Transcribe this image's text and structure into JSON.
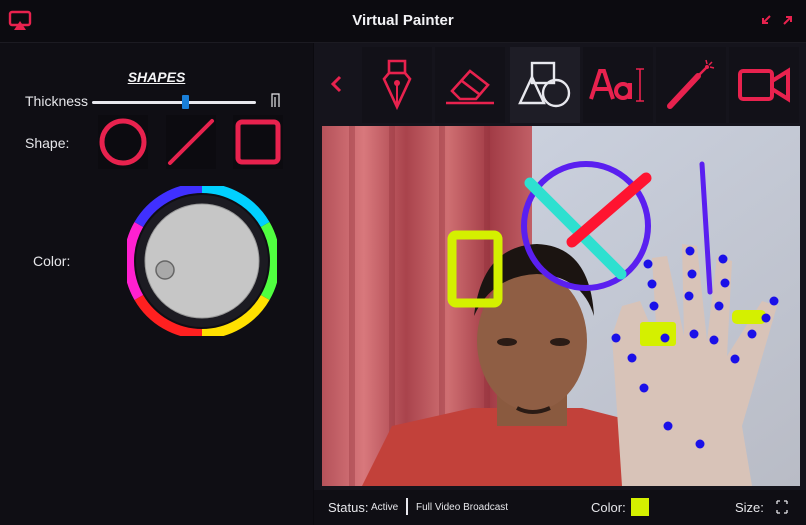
{
  "window": {
    "title": "Virtual Painter",
    "accent": "#e8224e"
  },
  "left_panel": {
    "title": "SHAPES",
    "thickness_label": "Thickness",
    "thickness_level": 0.58,
    "shape_label": "Shape:",
    "shapes": [
      "circle-icon",
      "line-icon",
      "square-icon"
    ],
    "color_label": "Color:"
  },
  "toolbar": {
    "tools": [
      "pen-icon",
      "eraser-icon",
      "shapes-icon",
      "text-icon",
      "laser-pointer-icon",
      "video-camera-icon"
    ],
    "selected": "shapes-icon"
  },
  "canvas": {
    "drawn_colors": [
      "#5a1ff0",
      "#ff1430",
      "#2ee0d0",
      "#d4f000",
      "#1a10e8"
    ]
  },
  "status_bar": {
    "status_label": "Status:",
    "status_value": "Active",
    "mode": "Full Video Broadcast",
    "color_label": "Color:",
    "color_value": "#d4f000",
    "size_label": "Size:"
  }
}
